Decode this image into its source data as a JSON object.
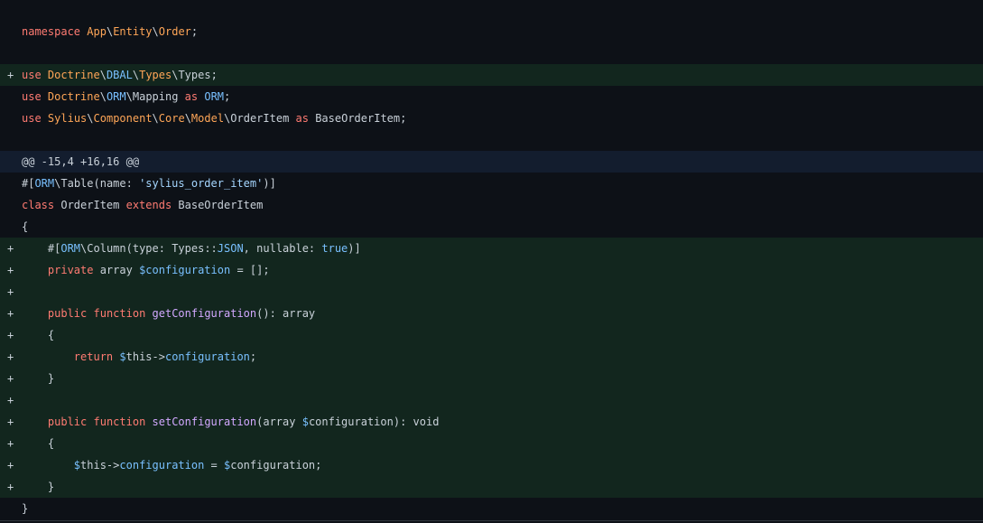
{
  "diff": {
    "lines": [
      {
        "type": "context",
        "marker": "",
        "tokens": [
          [
            "kw",
            "namespace"
          ],
          [
            "plain",
            " "
          ],
          [
            "ns",
            "App"
          ],
          [
            "plain",
            "\\"
          ],
          [
            "ns",
            "Entity"
          ],
          [
            "plain",
            "\\"
          ],
          [
            "ns",
            "Order"
          ],
          [
            "plain",
            ";"
          ]
        ]
      },
      {
        "type": "context",
        "marker": "",
        "tokens": []
      },
      {
        "type": "added",
        "marker": "+",
        "tokens": [
          [
            "kw",
            "use"
          ],
          [
            "plain",
            " "
          ],
          [
            "ns",
            "Doctrine"
          ],
          [
            "plain",
            "\\"
          ],
          [
            "ns2",
            "DBAL"
          ],
          [
            "plain",
            "\\"
          ],
          [
            "ns",
            "Types"
          ],
          [
            "plain",
            "\\Types;"
          ]
        ]
      },
      {
        "type": "context",
        "marker": "",
        "tokens": [
          [
            "kw",
            "use"
          ],
          [
            "plain",
            " "
          ],
          [
            "ns",
            "Doctrine"
          ],
          [
            "plain",
            "\\"
          ],
          [
            "ns2",
            "ORM"
          ],
          [
            "plain",
            "\\Mapping "
          ],
          [
            "kw",
            "as"
          ],
          [
            "plain",
            " "
          ],
          [
            "ns2",
            "ORM"
          ],
          [
            "plain",
            ";"
          ]
        ]
      },
      {
        "type": "context",
        "marker": "",
        "tokens": [
          [
            "kw",
            "use"
          ],
          [
            "plain",
            " "
          ],
          [
            "ns",
            "Sylius"
          ],
          [
            "plain",
            "\\"
          ],
          [
            "ns",
            "Component"
          ],
          [
            "plain",
            "\\"
          ],
          [
            "ns",
            "Core"
          ],
          [
            "plain",
            "\\"
          ],
          [
            "ns",
            "Model"
          ],
          [
            "plain",
            "\\OrderItem "
          ],
          [
            "kw",
            "as"
          ],
          [
            "plain",
            " BaseOrderItem;"
          ]
        ]
      },
      {
        "type": "context",
        "marker": "",
        "tokens": []
      },
      {
        "type": "hunk",
        "marker": "",
        "tokens": [
          [
            "plain",
            "@@ -15,4 +16,16 @@"
          ]
        ]
      },
      {
        "type": "context",
        "marker": "",
        "tokens": [
          [
            "plain",
            "#["
          ],
          [
            "ns2",
            "ORM"
          ],
          [
            "plain",
            "\\Table(name: "
          ],
          [
            "str",
            "'sylius_order_item'"
          ],
          [
            "plain",
            ")]"
          ]
        ]
      },
      {
        "type": "context",
        "marker": "",
        "tokens": [
          [
            "kw",
            "class"
          ],
          [
            "plain",
            " OrderItem "
          ],
          [
            "kw",
            "extends"
          ],
          [
            "plain",
            " BaseOrderItem"
          ]
        ]
      },
      {
        "type": "context",
        "marker": "",
        "tokens": [
          [
            "plain",
            "{"
          ]
        ]
      },
      {
        "type": "added",
        "marker": "+",
        "tokens": [
          [
            "plain",
            "    #["
          ],
          [
            "ns2",
            "ORM"
          ],
          [
            "plain",
            "\\Column(type: Types::"
          ],
          [
            "var",
            "JSON"
          ],
          [
            "plain",
            ", nullable: "
          ],
          [
            "var",
            "true"
          ],
          [
            "plain",
            ")]"
          ]
        ]
      },
      {
        "type": "added",
        "marker": "+",
        "tokens": [
          [
            "plain",
            "    "
          ],
          [
            "kw",
            "private"
          ],
          [
            "plain",
            " array "
          ],
          [
            "var",
            "$configuration"
          ],
          [
            "plain",
            " = [];"
          ]
        ]
      },
      {
        "type": "added",
        "marker": "+",
        "tokens": []
      },
      {
        "type": "added",
        "marker": "+",
        "tokens": [
          [
            "plain",
            "    "
          ],
          [
            "kw",
            "public"
          ],
          [
            "plain",
            " "
          ],
          [
            "kw",
            "function"
          ],
          [
            "plain",
            " "
          ],
          [
            "fn",
            "getConfiguration"
          ],
          [
            "plain",
            "(): array"
          ]
        ]
      },
      {
        "type": "added",
        "marker": "+",
        "tokens": [
          [
            "plain",
            "    {"
          ]
        ]
      },
      {
        "type": "added",
        "marker": "+",
        "tokens": [
          [
            "plain",
            "        "
          ],
          [
            "kw",
            "return"
          ],
          [
            "plain",
            " "
          ],
          [
            "var",
            "$"
          ],
          [
            "plain",
            "this->"
          ],
          [
            "var",
            "configuration"
          ],
          [
            "plain",
            ";"
          ]
        ]
      },
      {
        "type": "added",
        "marker": "+",
        "tokens": [
          [
            "plain",
            "    }"
          ]
        ]
      },
      {
        "type": "added",
        "marker": "+",
        "tokens": []
      },
      {
        "type": "added",
        "marker": "+",
        "tokens": [
          [
            "plain",
            "    "
          ],
          [
            "kw",
            "public"
          ],
          [
            "plain",
            " "
          ],
          [
            "kw",
            "function"
          ],
          [
            "plain",
            " "
          ],
          [
            "fn",
            "setConfiguration"
          ],
          [
            "plain",
            "(array "
          ],
          [
            "var",
            "$"
          ],
          [
            "plain",
            "configuration): void"
          ]
        ]
      },
      {
        "type": "added",
        "marker": "+",
        "tokens": [
          [
            "plain",
            "    {"
          ]
        ]
      },
      {
        "type": "added",
        "marker": "+",
        "tokens": [
          [
            "plain",
            "        "
          ],
          [
            "var",
            "$"
          ],
          [
            "plain",
            "this->"
          ],
          [
            "var",
            "configuration"
          ],
          [
            "plain",
            " = "
          ],
          [
            "var",
            "$"
          ],
          [
            "plain",
            "configuration;"
          ]
        ]
      },
      {
        "type": "added",
        "marker": "+",
        "tokens": [
          [
            "plain",
            "    }"
          ]
        ]
      },
      {
        "type": "context",
        "marker": "",
        "tokens": [
          [
            "plain",
            "}"
          ]
        ]
      }
    ]
  }
}
